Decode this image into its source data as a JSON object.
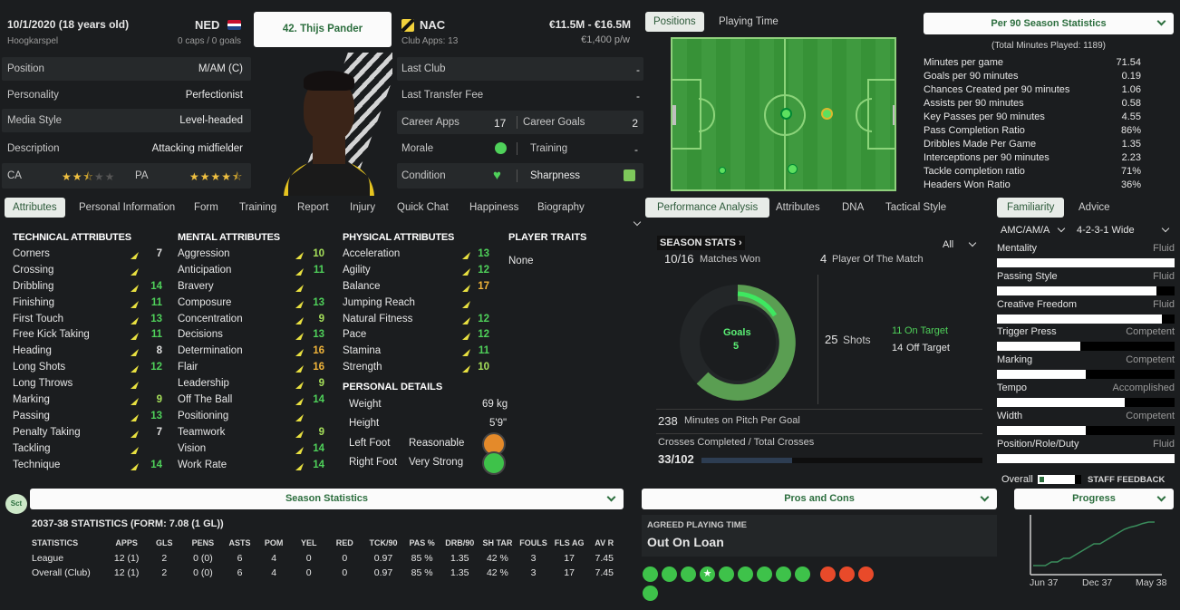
{
  "player": {
    "dob": "10/1/2020 (18 years old)",
    "nation": "NED",
    "birthplace": "Hoogkarspel",
    "caps": "0 caps / 0 goals",
    "name_button": "42. Thijs Pander",
    "club": "NAC",
    "club_apps": "Club Apps: 13",
    "value": "€11.5M - €16.5M",
    "wage": "€1,400 p/w"
  },
  "profile": [
    {
      "label": "Position",
      "value": "M/AM (C)"
    },
    {
      "label": "Personality",
      "value": "Perfectionist"
    },
    {
      "label": "Media Style",
      "value": "Level-headed"
    },
    {
      "label": "Description",
      "value": "Attacking midfielder"
    }
  ],
  "ability": {
    "ca_label": "CA",
    "pa_label": "PA",
    "ca_stars": 2.5,
    "pa_stars": 4.5
  },
  "club_info": {
    "last_club_label": "Last Club",
    "last_club": "-",
    "last_fee_label": "Last Transfer Fee",
    "last_fee": "-",
    "career_apps_label": "Career Apps",
    "career_apps": "17",
    "career_goals_label": "Career Goals",
    "career_goals": "2",
    "morale_label": "Morale",
    "training_label": "Training",
    "training": "-",
    "condition_label": "Condition",
    "sharpness_label": "Sharpness"
  },
  "top_tabs": [
    "Positions",
    "Playing Time"
  ],
  "per90": {
    "dropdown": "Per 90 Season Statistics",
    "total": "(Total Minutes Played: 1189)",
    "rows": [
      {
        "label": "Minutes per game",
        "value": "71.54"
      },
      {
        "label": "Goals per 90 minutes",
        "value": "0.19"
      },
      {
        "label": "Chances Created per 90 minutes",
        "value": "1.06"
      },
      {
        "label": "Assists per 90 minutes",
        "value": "0.58"
      },
      {
        "label": "Key Passes per 90 minutes",
        "value": "4.55"
      },
      {
        "label": "Pass Completion Ratio",
        "value": "86%"
      },
      {
        "label": "Dribbles Made Per Game",
        "value": "1.35"
      },
      {
        "label": "Interceptions per 90 minutes",
        "value": "2.23"
      },
      {
        "label": "Tackle completion ratio",
        "value": "71%"
      },
      {
        "label": "Headers Won Ratio",
        "value": "36%"
      }
    ]
  },
  "main_tabs": [
    "Attributes",
    "Personal Information",
    "Form",
    "Training",
    "Report",
    "Injury",
    "Quick Chat",
    "Happiness",
    "Biography"
  ],
  "mid_tabs": [
    "Performance Analysis",
    "Attributes",
    "DNA",
    "Tactical Style"
  ],
  "right_tabs": [
    "Familiarity",
    "Advice"
  ],
  "technical": {
    "title": "TECHNICAL ATTRIBUTES",
    "items": [
      {
        "n": "Corners",
        "v": "7"
      },
      {
        "n": "Crossing",
        "v": ""
      },
      {
        "n": "Dribbling",
        "v": "14"
      },
      {
        "n": "Finishing",
        "v": "11"
      },
      {
        "n": "First Touch",
        "v": "13"
      },
      {
        "n": "Free Kick Taking",
        "v": "11"
      },
      {
        "n": "Heading",
        "v": "8"
      },
      {
        "n": "Long Shots",
        "v": "12"
      },
      {
        "n": "Long Throws",
        "v": ""
      },
      {
        "n": "Marking",
        "v": "9"
      },
      {
        "n": "Passing",
        "v": "13"
      },
      {
        "n": "Penalty Taking",
        "v": "7"
      },
      {
        "n": "Tackling",
        "v": ""
      },
      {
        "n": "Technique",
        "v": "14"
      }
    ]
  },
  "mental": {
    "title": "MENTAL ATTRIBUTES",
    "items": [
      {
        "n": "Aggression",
        "v": "10"
      },
      {
        "n": "Anticipation",
        "v": "11"
      },
      {
        "n": "Bravery",
        "v": ""
      },
      {
        "n": "Composure",
        "v": "13"
      },
      {
        "n": "Concentration",
        "v": "9"
      },
      {
        "n": "Decisions",
        "v": "13"
      },
      {
        "n": "Determination",
        "v": "16"
      },
      {
        "n": "Flair",
        "v": "16"
      },
      {
        "n": "Leadership",
        "v": "9"
      },
      {
        "n": "Off The Ball",
        "v": "14"
      },
      {
        "n": "Positioning",
        "v": ""
      },
      {
        "n": "Teamwork",
        "v": "9"
      },
      {
        "n": "Vision",
        "v": "14"
      },
      {
        "n": "Work Rate",
        "v": "14"
      }
    ]
  },
  "physical": {
    "title": "PHYSICAL ATTRIBUTES",
    "items": [
      {
        "n": "Acceleration",
        "v": "13"
      },
      {
        "n": "Agility",
        "v": "12"
      },
      {
        "n": "Balance",
        "v": "17"
      },
      {
        "n": "Jumping Reach",
        "v": ""
      },
      {
        "n": "Natural Fitness",
        "v": "12"
      },
      {
        "n": "Pace",
        "v": "12"
      },
      {
        "n": "Stamina",
        "v": "11"
      },
      {
        "n": "Strength",
        "v": "10"
      }
    ]
  },
  "traits": {
    "title": "PLAYER TRAITS",
    "value": "None"
  },
  "personal": {
    "title": "PERSONAL DETAILS",
    "weight_label": "Weight",
    "weight": "69 kg",
    "height_label": "Height",
    "height": "5'9\"",
    "left_foot_label": "Left Foot",
    "left_foot": "Reasonable",
    "right_foot_label": "Right Foot",
    "right_foot": "Very Strong"
  },
  "season_stats": {
    "title": "SEASON STATS",
    "filter": "All",
    "matches_won": "10/16",
    "matches_won_label": "Matches Won",
    "potm": "4",
    "potm_label": "Player Of The Match",
    "goals_label": "Goals",
    "goals": "5",
    "shots": "25",
    "shots_label": "Shots",
    "on_target": "11",
    "on_target_label": "On Target",
    "off_target": "14",
    "off_target_label": "Off Target",
    "mins_per_goal": "238",
    "mins_per_goal_label": "Minutes on Pitch Per Goal",
    "crosses_label": "Crosses Completed / Total Crosses",
    "crosses": "33/102"
  },
  "familiarity": {
    "position": "AMC/AM/A",
    "formation": "4-2-3-1 Wide",
    "rows": [
      {
        "n": "Mentality",
        "v": "Fluid",
        "fill": 1.0
      },
      {
        "n": "Passing Style",
        "v": "Fluid",
        "fill": 0.9
      },
      {
        "n": "Creative Freedom",
        "v": "Fluid",
        "fill": 0.93
      },
      {
        "n": "Trigger Press",
        "v": "Competent",
        "fill": 0.47
      },
      {
        "n": "Marking",
        "v": "Competent",
        "fill": 0.5
      },
      {
        "n": "Tempo",
        "v": "Accomplished",
        "fill": 0.72
      },
      {
        "n": "Width",
        "v": "Competent",
        "fill": 0.5
      },
      {
        "n": "Position/Role/Duty",
        "v": "Fluid",
        "fill": 1.0
      }
    ],
    "overall_label": "Overall",
    "overall_fill": 0.85,
    "staff_feedback": "STAFF FEEDBACK"
  },
  "bottom": {
    "sct": "Sct",
    "season_statistics": "Season Statistics",
    "pros_cons": "Pros and Cons",
    "progress": "Progress",
    "stats_title": "2037-38 STATISTICS (FORM: 7.08 (1 GL))",
    "columns": [
      "STATISTICS",
      "APPS",
      "GLS",
      "PENS",
      "ASTS",
      "POM",
      "YEL",
      "RED",
      "TCK/90",
      "PAS %",
      "DRB/90",
      "SH TAR",
      "FOULS",
      "FLS AG",
      "AV R"
    ],
    "rows": [
      [
        "League",
        "12 (1)",
        "2",
        "0 (0)",
        "6",
        "4",
        "0",
        "0",
        "0.97",
        "85 %",
        "1.35",
        "42 %",
        "3",
        "17",
        "7.45"
      ],
      [
        "Overall (Club)",
        "12 (1)",
        "2",
        "0 (0)",
        "6",
        "4",
        "0",
        "0",
        "0.97",
        "85 %",
        "1.35",
        "42 %",
        "3",
        "17",
        "7.45"
      ]
    ],
    "agreed_label": "AGREED PLAYING TIME",
    "agreed_value": "Out On Loan",
    "progress_x": [
      "Jun 37",
      "Dec 37",
      "May 38"
    ],
    "progress_values": [
      1,
      1,
      1,
      1.5,
      1.5,
      2,
      2,
      2.5,
      3,
      3.5,
      4,
      4,
      4.5,
      5,
      5.5,
      6,
      6.3,
      6.5,
      6.8,
      7,
      7
    ]
  },
  "colors": {
    "accent": "#2c6e3e",
    "good": "#4fd15a",
    "warn": "#f0b43a",
    "pitch": "#3f9a3f"
  }
}
